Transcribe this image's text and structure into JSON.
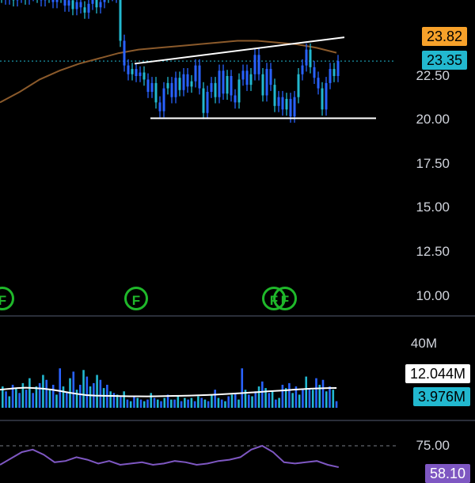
{
  "price_axis": {
    "ticks": [
      "22.50",
      "20.00",
      "17.50",
      "15.00",
      "12.50",
      "10.00"
    ],
    "tick_values": [
      22.5,
      20.0,
      17.5,
      15.0,
      12.5,
      10.0
    ]
  },
  "badges": {
    "ma_value": "23.82",
    "last_price": "23.35",
    "volume_ma": "12.044M",
    "volume": "3.976M",
    "rsi_value": "58.10"
  },
  "volume_axis": {
    "top_tick": "40M"
  },
  "rsi_axis": {
    "tick": "75.00"
  },
  "event_markers": [
    "F",
    "F",
    "F",
    "F"
  ],
  "colors": {
    "background": "#000000",
    "candle": "#2962ff",
    "candle_alt": "#22b8cf",
    "moving_average": "#8b5a2b",
    "trendline": "#ffffff",
    "last_price_line": "#22b8cf",
    "volume_ma_line": "#ffffff",
    "rsi_line": "#7e57c2",
    "earnings_marker": "#1fb82a"
  },
  "chart_data": {
    "type": "line",
    "title": "",
    "ylim": [
      8.9,
      27.4
    ],
    "price_series": {
      "name": "",
      "x": [
        0,
        5,
        10,
        15,
        20,
        25,
        30,
        35,
        40,
        45,
        50,
        55,
        60,
        65,
        70,
        75,
        80,
        85,
        90,
        95,
        100,
        105,
        110,
        115,
        120,
        125,
        130,
        135,
        140,
        145,
        150,
        155,
        160,
        165,
        170,
        175,
        180,
        185,
        190,
        195,
        200,
        205,
        210,
        215,
        220,
        225,
        230,
        235,
        240,
        245,
        250,
        255,
        260,
        265,
        270,
        275,
        280,
        285,
        290,
        295,
        300,
        305,
        310,
        315,
        320,
        325,
        330,
        335,
        340,
        345,
        350,
        355,
        360,
        365,
        370,
        375,
        380,
        385,
        390,
        395,
        400,
        405,
        410,
        415,
        420,
        425
      ],
      "values": [
        27.0,
        26.9,
        27.1,
        26.8,
        27.2,
        27.0,
        26.9,
        27.1,
        27.3,
        27.0,
        26.8,
        27.1,
        27.0,
        26.7,
        27.2,
        27.0,
        26.5,
        26.8,
        26.3,
        26.7,
        26.4,
        26.1,
        26.6,
        26.9,
        26.4,
        26.7,
        27.0,
        27.1,
        27.2,
        27.0,
        24.5,
        23.1,
        22.6,
        22.9,
        22.5,
        22.7,
        22.3,
        21.6,
        22.1,
        21.0,
        20.5,
        21.8,
        22.1,
        21.3,
        22.4,
        21.7,
        22.6,
        21.9,
        22.2,
        23.1,
        21.8,
        20.4,
        21.6,
        22.1,
        21.3,
        22.8,
        21.5,
        22.5,
        21.4,
        21.0,
        22.3,
        22.8,
        22.0,
        22.6,
        23.7,
        22.6,
        21.4,
        22.9,
        22.0,
        20.8,
        21.3,
        20.6,
        21.2,
        20.2,
        21.3,
        22.6,
        23.1,
        24.0,
        23.0,
        22.4,
        21.8,
        20.6,
        22.1,
        22.9,
        22.5,
        23.35
      ]
    },
    "moving_average": {
      "name": "",
      "x": [
        0,
        25,
        50,
        75,
        100,
        125,
        150,
        175,
        200,
        225,
        250,
        275,
        300,
        325,
        350,
        375,
        400,
        425
      ],
      "values": [
        21.0,
        21.6,
        22.3,
        22.8,
        23.2,
        23.5,
        23.8,
        24.0,
        24.1,
        24.2,
        24.3,
        24.4,
        24.5,
        24.5,
        24.4,
        24.3,
        24.1,
        23.82
      ]
    },
    "trendlines": [
      {
        "x": [
          170,
          435
        ],
        "values": [
          23.2,
          24.7
        ]
      },
      {
        "x": [
          190,
          475
        ],
        "values": [
          20.1,
          20.1
        ]
      }
    ],
    "volume_series": {
      "ylim": [
        0,
        45
      ],
      "values": [
        13,
        10,
        7,
        14,
        12,
        9,
        15,
        11,
        18,
        9,
        13,
        15,
        20,
        17,
        11,
        14,
        8,
        24,
        13,
        9,
        18,
        22,
        11,
        14,
        23,
        19,
        13,
        15,
        20,
        17,
        12,
        14,
        10,
        9,
        8,
        7,
        10,
        5,
        4,
        7,
        6,
        5,
        4,
        5,
        9,
        6,
        5,
        4,
        6,
        8,
        5,
        5,
        7,
        4,
        6,
        5,
        6,
        4,
        7,
        6,
        5,
        4,
        8,
        11,
        6,
        5,
        4,
        7,
        8,
        9,
        5,
        24,
        11,
        8,
        7,
        10,
        13,
        16,
        12,
        9,
        10,
        5,
        6,
        14,
        12,
        15,
        9,
        13,
        8,
        11,
        19,
        12,
        11,
        18,
        14,
        17,
        10,
        13,
        11,
        4
      ],
      "ma_values": [
        11,
        11.5,
        12,
        12.2,
        12,
        11.6,
        11,
        10.2,
        9.2,
        8.4,
        7.7,
        7.4,
        7.3,
        7.2,
        7.1,
        7.0,
        7.0,
        6.9,
        7.0,
        7.1,
        7.2,
        7.3,
        7.4,
        7.6,
        7.8,
        8.0,
        8.3,
        8.6,
        8.9,
        9.3,
        9.6,
        10.0,
        10.3,
        10.6,
        11.0,
        11.3,
        11.6,
        11.8,
        12.0,
        12.044
      ]
    },
    "rsi_series": {
      "ylim": [
        45,
        80
      ],
      "values": [
        60,
        65,
        70,
        72,
        68,
        62,
        63,
        66,
        64,
        61,
        63,
        60,
        61,
        62,
        60,
        61,
        63,
        62,
        60,
        61,
        63,
        64,
        66,
        72,
        75,
        70,
        62,
        61,
        62,
        63,
        60,
        58.1
      ]
    }
  }
}
